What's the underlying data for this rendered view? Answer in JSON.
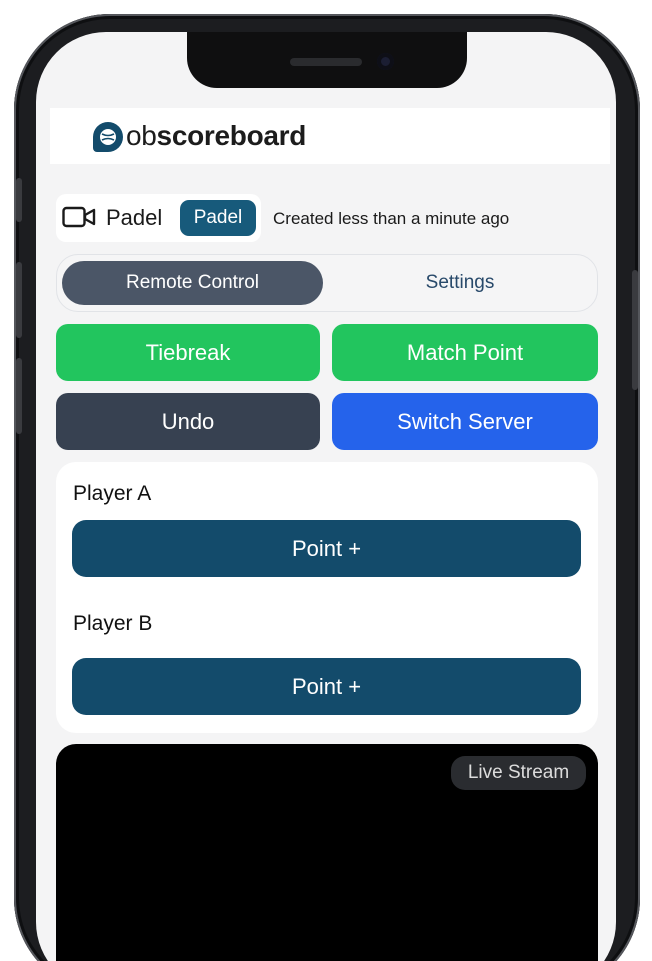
{
  "app": {
    "logo_prefix": "ob",
    "logo_suffix": "scoreboard"
  },
  "match": {
    "name": "Padel",
    "badge": "Padel",
    "created": "Created less than a minute ago"
  },
  "tabs": [
    {
      "label": "Remote Control",
      "active": true
    },
    {
      "label": "Settings",
      "active": false
    }
  ],
  "actions": {
    "tiebreak": "Tiebreak",
    "match_point": "Match Point",
    "undo": "Undo",
    "switch_server": "Switch Server"
  },
  "players": [
    {
      "name": "Player A",
      "point_label": "Point +"
    },
    {
      "name": "Player B",
      "point_label": "Point +"
    }
  ],
  "stream": {
    "badge": "Live Stream"
  },
  "colors": {
    "brand": "#134b6b",
    "green": "#22c55e",
    "dark": "#374151",
    "blue": "#2563eb",
    "tab_active": "#4b5667"
  }
}
